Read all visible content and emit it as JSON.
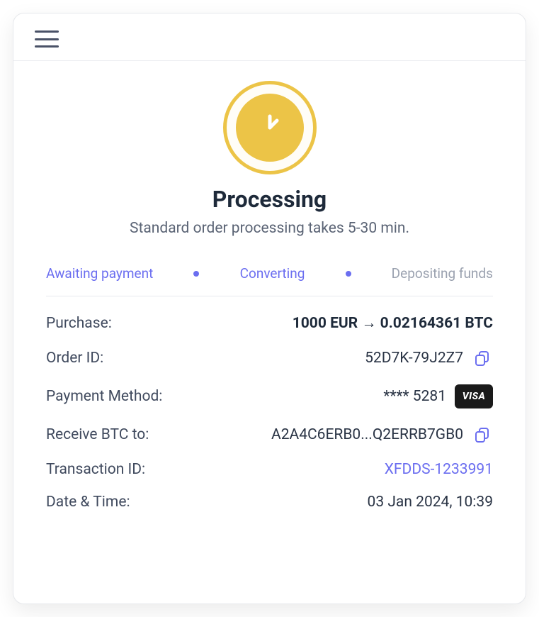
{
  "status": {
    "title": "Processing",
    "subtitle": "Standard order processing takes 5-30 min."
  },
  "steps": {
    "s1": "Awaiting payment",
    "s2": "Converting",
    "s3": "Depositing funds"
  },
  "details": {
    "purchase_label": "Purchase:",
    "purchase_value": "1000 EUR → 0.02164361 BTC",
    "order_id_label": "Order ID:",
    "order_id_value": "52D7K-79J2Z7",
    "payment_method_label": "Payment Method:",
    "payment_method_value": "**** 5281",
    "payment_brand": "VISA",
    "receive_to_label": "Receive BTC to:",
    "receive_to_value": "A2A4C6ERB0...Q2ERRB7GB0",
    "transaction_id_label": "Transaction ID:",
    "transaction_id_value": "XFDDS-1233991",
    "datetime_label": "Date & Time:",
    "datetime_value": "03 Jan 2024, 10:39"
  }
}
